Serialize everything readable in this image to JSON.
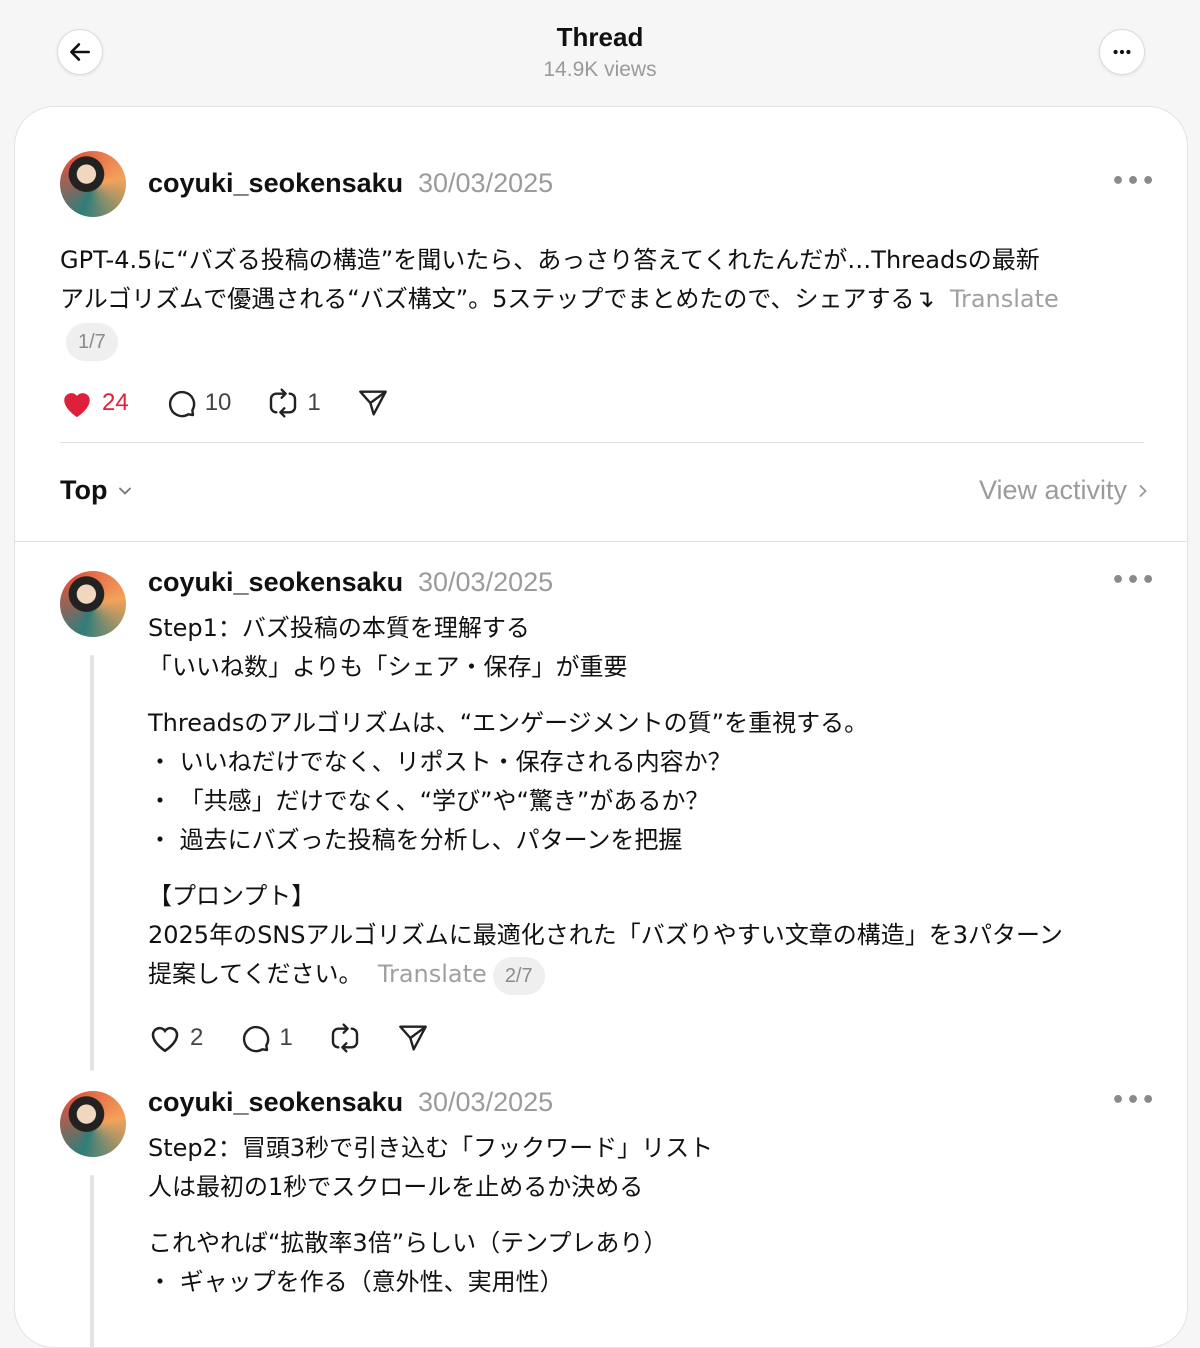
{
  "header": {
    "title": "Thread",
    "views": "14.9K views",
    "back_icon": "arrow-left-icon",
    "more_icon": "more-horizontal-icon"
  },
  "main_post": {
    "username": "coyuki_seokensaku",
    "date": "30/03/2025",
    "lines": [
      "GPT-4.5に“バズる投稿の構造”を聞いたら、あっさり答えてくれたんだが…Threadsの最新",
      "アルゴリズムで優遇される“バズ構文”。5ステップでまとめたので、シェアする↴"
    ],
    "translate": "Translate",
    "pager": "1/7",
    "likes": "24",
    "replies": "10",
    "reposts": "1",
    "liked": true
  },
  "sort": {
    "label": "Top",
    "view_activity": "View activity"
  },
  "replies": [
    {
      "username": "coyuki_seokensaku",
      "date": "30/03/2025",
      "paragraphs": [
        [
          "Step1：バズ投稿の本質を理解する",
          "「いいね数」よりも「シェア・保存」が重要"
        ],
        [
          "Threadsのアルゴリズムは、“エンゲージメントの質”を重視する。",
          "・ いいねだけでなく、リポスト・保存される内容か？",
          "・ 「共感」だけでなく、“学び”や“驚き”があるか？",
          "・ 過去にバズった投稿を分析し、パターンを把握"
        ],
        [
          "【プロンプト】",
          "2025年のSNSアルゴリズムに最適化された「バズりやすい文章の構造」を3パターン"
        ]
      ],
      "last_line": "提案してください。",
      "translate": "Translate",
      "pager": "2/7",
      "likes": "2",
      "replies": "1"
    },
    {
      "username": "coyuki_seokensaku",
      "date": "30/03/2025",
      "paragraphs": [
        [
          "Step2：冒頭3秒で引き込む「フックワード」リスト",
          "人は最初の1秒でスクロールを止めるか決める"
        ],
        [
          "これやれば“拡散率3倍”らしい（テンプレあり）",
          "・ ギャップを作る（意外性、実用性）"
        ]
      ]
    }
  ],
  "colors": {
    "like_red": "#e0203a",
    "muted": "#9b9b9b"
  }
}
